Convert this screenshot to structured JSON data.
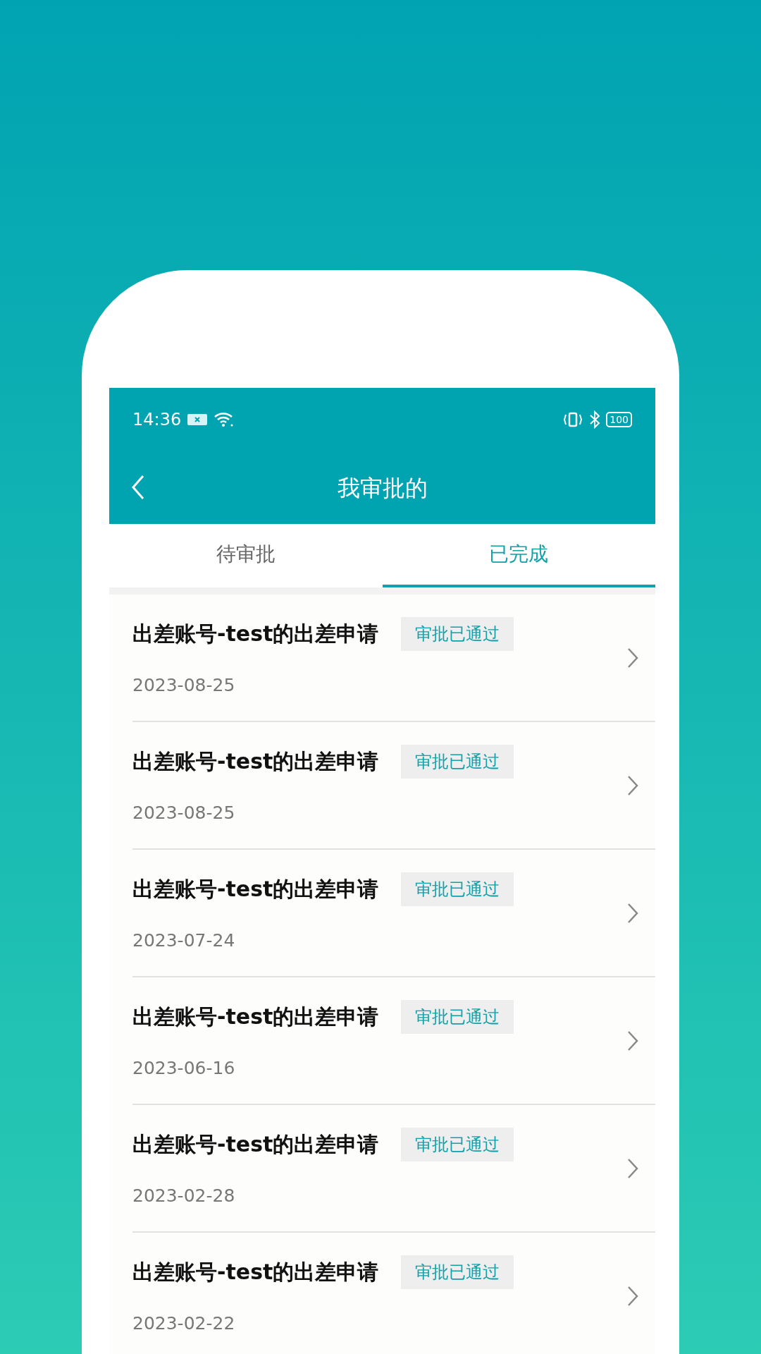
{
  "status_bar": {
    "time": "14:36",
    "battery": "100"
  },
  "header": {
    "title": "我审批的"
  },
  "tabs": [
    {
      "label": "待审批",
      "selected": false
    },
    {
      "label": "已完成",
      "selected": true
    }
  ],
  "items": [
    {
      "title": "出差账号-test的出差申请",
      "status": "审批已通过",
      "date": "2023-08-25"
    },
    {
      "title": "出差账号-test的出差申请",
      "status": "审批已通过",
      "date": "2023-08-25"
    },
    {
      "title": "出差账号-test的出差申请",
      "status": "审批已通过",
      "date": "2023-07-24"
    },
    {
      "title": "出差账号-test的出差申请",
      "status": "审批已通过",
      "date": "2023-06-16"
    },
    {
      "title": "出差账号-test的出差申请",
      "status": "审批已通过",
      "date": "2023-02-28"
    },
    {
      "title": "出差账号-test的出差申请",
      "status": "审批已通过",
      "date": "2023-02-22"
    }
  ]
}
